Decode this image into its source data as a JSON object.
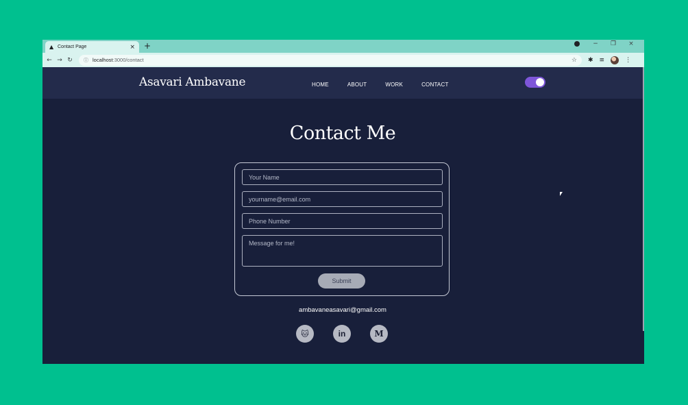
{
  "browser": {
    "tab_title": "Contact Page",
    "favicon": "▲",
    "tab_close": "×",
    "new_tab": "+",
    "url_host": "localhost",
    "url_path": ":3000/contact",
    "controls": {
      "minimize": "−",
      "restore": "❐",
      "close": "×"
    }
  },
  "site": {
    "brand": "Asavari Ambavane",
    "nav": [
      "HOME",
      "ABOUT",
      "WORK",
      "CONTACT"
    ],
    "theme_toggle_on": true
  },
  "contact": {
    "heading": "Contact Me",
    "name_placeholder": "Your Name",
    "email_placeholder": "yourname@email.com",
    "phone_placeholder": "Phone Number",
    "message_placeholder": "Message for me!",
    "submit_label": "Submit",
    "email_text": "ambavaneasavari@gmail.com",
    "socials": {
      "github": "🐱",
      "linkedin": "in",
      "medium": "M"
    }
  },
  "colors": {
    "backdrop": "#00c08f",
    "page_bg": "#181f3a",
    "navbar_bg": "#232b4b",
    "toggle": "#7e56d9"
  }
}
